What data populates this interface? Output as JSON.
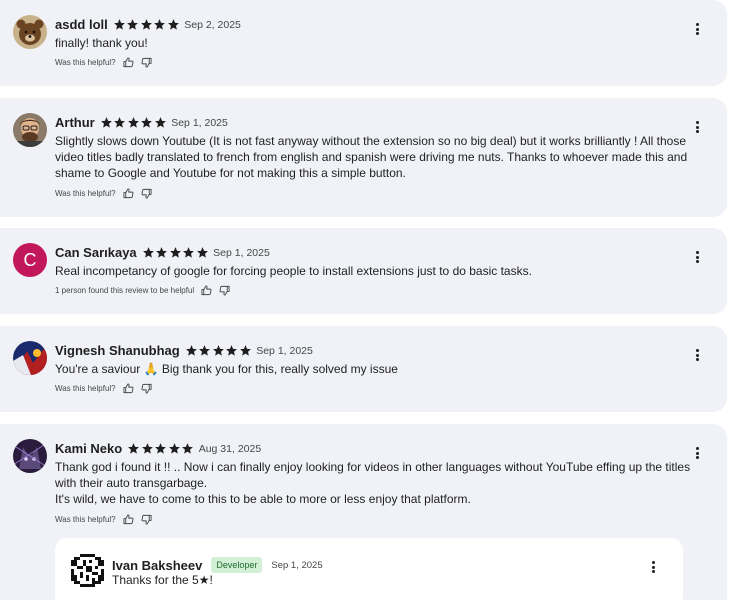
{
  "reviews": [
    {
      "name": "asdd loll",
      "rating": 5,
      "date": "Sep 2, 2025",
      "text": "finally! thank you!",
      "helpful": "Was this helpful?",
      "avatar": "bear-photo"
    },
    {
      "name": "Arthur",
      "rating": 5,
      "date": "Sep 1, 2025",
      "text": "Slightly slows down Youtube (It is not fast anyway without the extension so no big deal) but it works brilliantly ! All those video titles badly translated to french from english and spanish were driving me nuts. Thanks to whoever made this and shame to Google and Youtube for not making this a simple button.",
      "helpful": "Was this helpful?",
      "avatar": "man-photo"
    },
    {
      "name": "Can Sarıkaya",
      "rating": 5,
      "date": "Sep 1, 2025",
      "text": "Real incompetancy of google for forcing people to install extensions just to do basic tasks.",
      "helpful": "1 person found this review to be helpful",
      "avatar_letter": "C",
      "avatar_color": "#c2185b"
    },
    {
      "name": "Vignesh Shanubhag",
      "rating": 5,
      "date": "Sep 1, 2025",
      "text": "You're a saviour 🙏 Big thank you for this, really solved my issue",
      "helpful": "Was this helpful?",
      "avatar": "anime-photo"
    },
    {
      "name": "Kami Neko",
      "rating": 5,
      "date": "Aug 31, 2025",
      "text_lines": [
        "Thank god i found it !! .. Now i can finally enjoy looking for videos in other languages without YouTube effing up the titles with their auto transgarbage.",
        "It's wild, we have to come to this to be able to more or less enjoy that platform."
      ],
      "helpful": "Was this helpful?",
      "avatar": "cat-photo"
    }
  ],
  "reply": {
    "name": "Ivan Baksheev",
    "badge": "Developer",
    "date": "Sep 1, 2025",
    "text": "Thanks for the 5★!",
    "avatar": "pixel-logo"
  },
  "colors": {
    "card_bg": "#f0f2f7",
    "badge_bg": "#d3f0d6",
    "badge_text": "#1e6b2d",
    "avatar_letter_bg": "#c2185b"
  }
}
